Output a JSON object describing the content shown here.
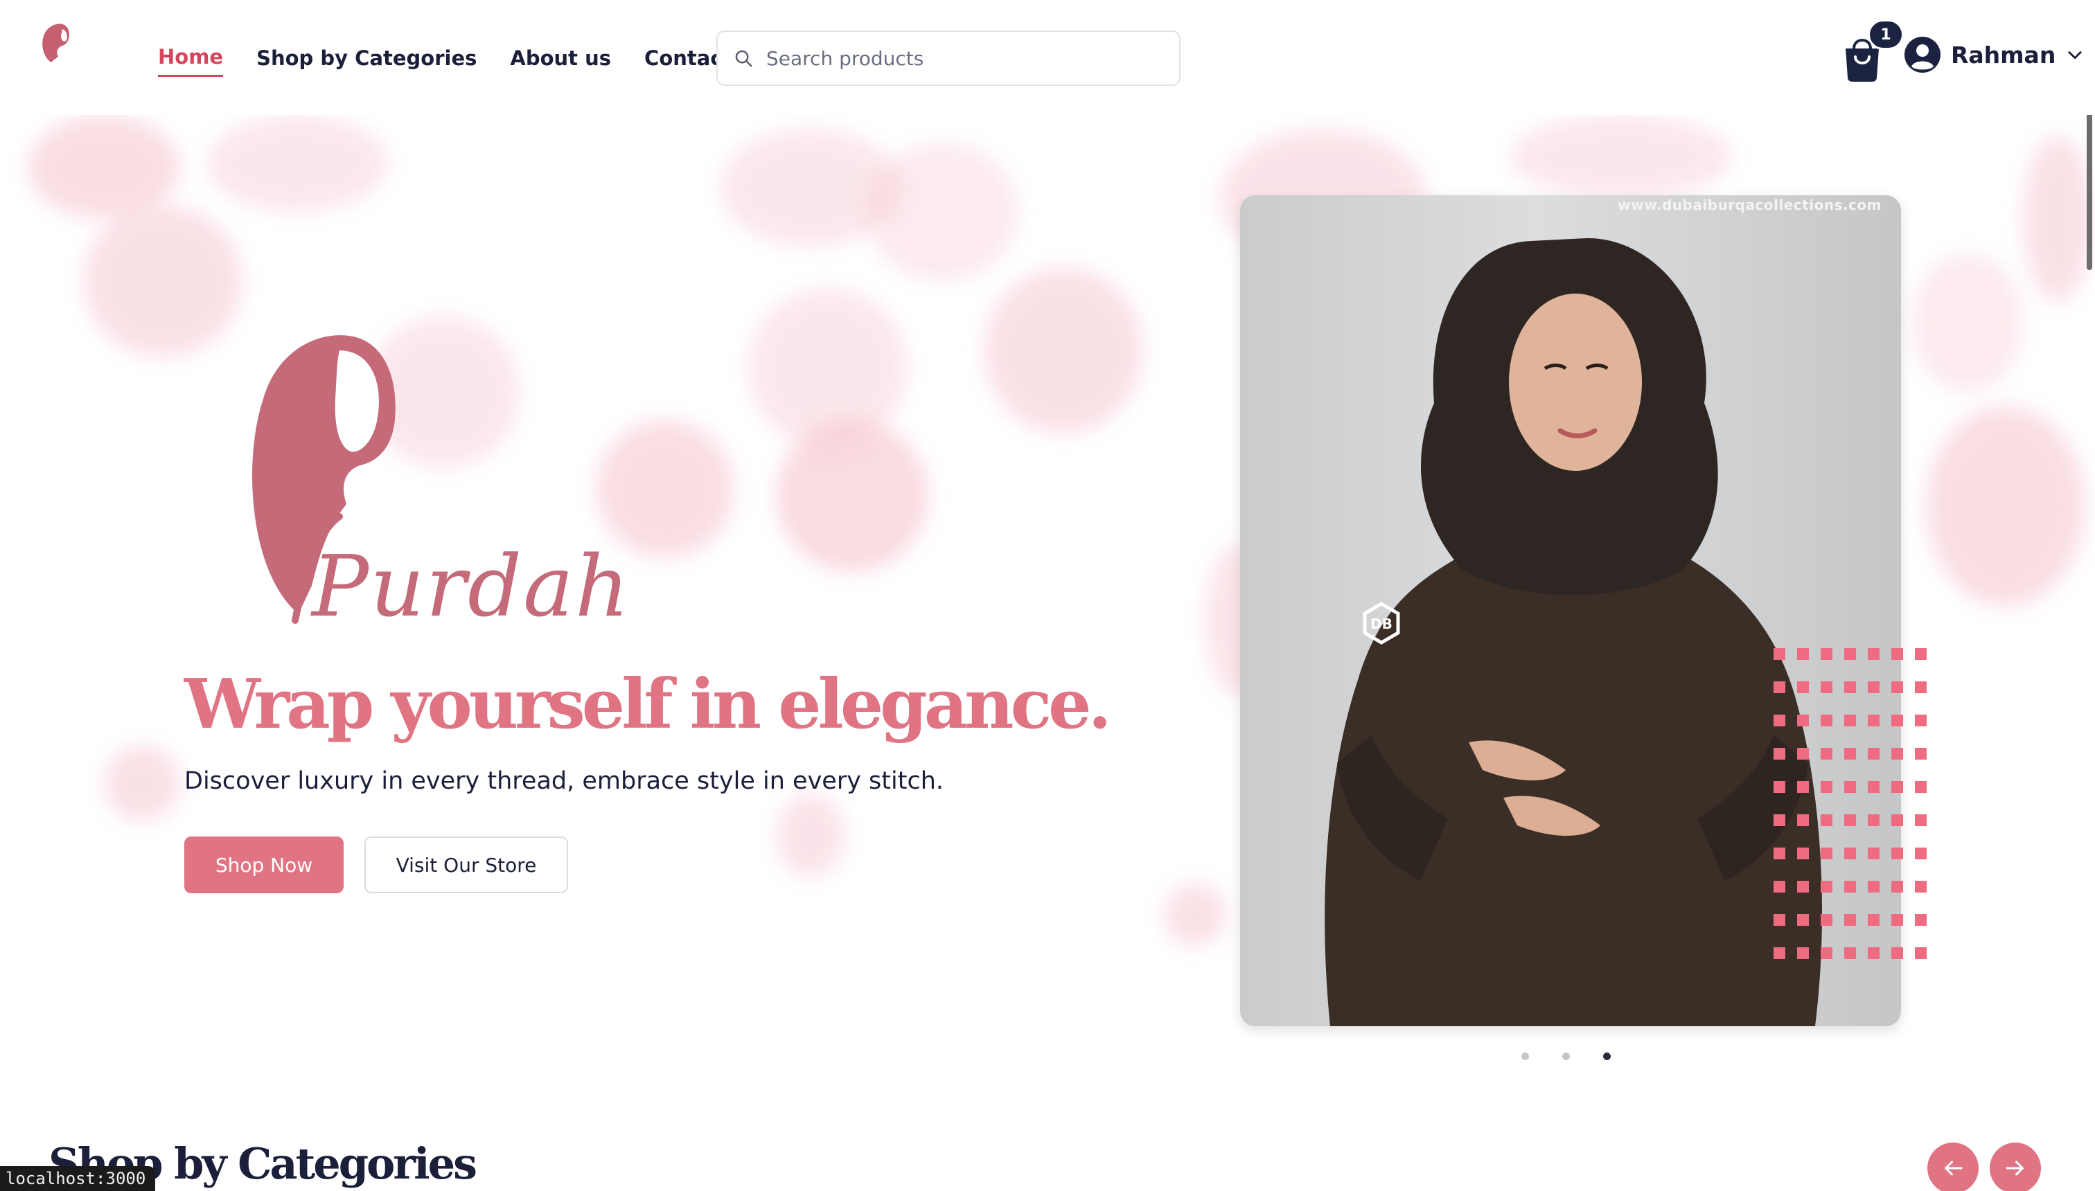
{
  "header": {
    "nav": [
      {
        "label": "Home",
        "active": true
      },
      {
        "label": "Shop by Categories",
        "active": false
      },
      {
        "label": "About us",
        "active": false
      },
      {
        "label": "Contact us",
        "active": false
      }
    ],
    "search": {
      "placeholder": "Search products",
      "value": ""
    },
    "cart_count": "1",
    "user_name": "Rahman",
    "brand_logo_text": "Purdah"
  },
  "hero": {
    "logo_text": "Purdah",
    "headline": "Wrap yourself in elegance.",
    "subheadline": "Discover luxury in every thread, embrace style in every stitch.",
    "primary_button": "Shop Now",
    "secondary_button": "Visit Our Store",
    "slide_watermark": "www.dubaiburqacollections.com",
    "carousel": {
      "total": 3,
      "active_index": 2
    }
  },
  "categories_section": {
    "title": "Shop by Categories"
  },
  "status_url": "localhost:3000",
  "colors": {
    "accent": "#e07483",
    "active_nav": "#d6455c",
    "text": "#1c1f3a",
    "badge": "#1c2340"
  },
  "icons": [
    "search-icon",
    "shopping-bag-icon",
    "user-avatar-icon",
    "chevron-down-icon",
    "arrow-left-icon",
    "arrow-right-icon"
  ]
}
